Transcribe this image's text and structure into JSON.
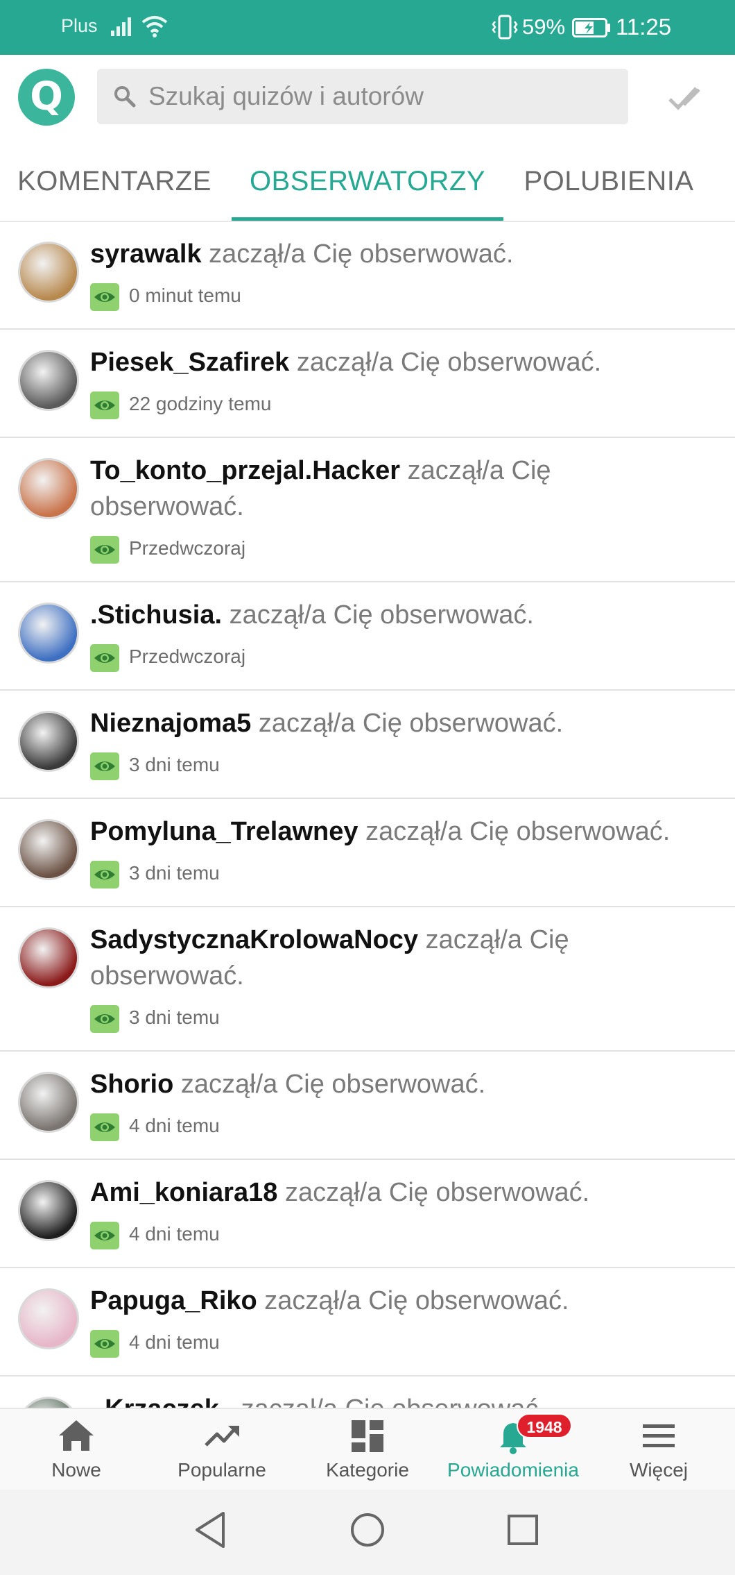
{
  "status_bar": {
    "carrier": "Plus",
    "battery_percent": "59%",
    "time": "11:25",
    "icons": [
      "signal-icon",
      "wifi-icon",
      "vibrate-icon",
      "battery-charging-icon"
    ]
  },
  "header": {
    "logo_letter": "Q",
    "search_placeholder": "Szukaj quizów i autorów",
    "search_value": "",
    "icons": [
      "search-icon",
      "mark-all-read-check-icon"
    ]
  },
  "tabs": [
    {
      "label": "KOMENTARZE",
      "active": false
    },
    {
      "label": "OBSERWATORZY",
      "active": true
    },
    {
      "label": "POLUBIENIA",
      "active": false
    }
  ],
  "notifications": [
    {
      "user": "syrawalk",
      "action": "zaczął/a Cię obserwować.",
      "time": "0 minut temu",
      "avatar_color": "#b8894e"
    },
    {
      "user": "Piesek_Szafirek",
      "action": "zaczął/a Cię obserwować.",
      "time": "22 godziny temu",
      "avatar_color": "#5a5a5a"
    },
    {
      "user": "To_konto_przejal.Hacker",
      "action": "zaczął/a Cię obserwować.",
      "time": "Przedwczoraj",
      "avatar_color": "#c9734a"
    },
    {
      "user": ".Stichusia.",
      "action": "zaczął/a Cię obserwować.",
      "time": "Przedwczoraj",
      "avatar_color": "#3d6fc2"
    },
    {
      "user": "Nieznajoma5",
      "action": "zaczął/a Cię obserwować.",
      "time": "3 dni temu",
      "avatar_color": "#3a3a3a"
    },
    {
      "user": "Pomyluna_Trelawney",
      "action": "zaczął/a Cię obserwować.",
      "time": "3 dni temu",
      "avatar_color": "#6b5244"
    },
    {
      "user": "SadystycznaKrolowaNocy",
      "action": "zaczął/a Cię obserwować.",
      "time": "3 dni temu",
      "avatar_color": "#8b1a1a"
    },
    {
      "user": "Shorio",
      "action": "zaczął/a Cię obserwować.",
      "time": "4 dni temu",
      "avatar_color": "#7a7570"
    },
    {
      "user": "Ami_koniara18",
      "action": "zaczął/a Cię obserwować.",
      "time": "4 dni temu",
      "avatar_color": "#1f1f1f"
    },
    {
      "user": "Papuga_Riko",
      "action": "zaczął/a Cię obserwować.",
      "time": "4 dni temu",
      "avatar_color": "#e7b6c8"
    },
    {
      "user": "_Krzaczek_",
      "action": "zaczął/a Cię obserwować.",
      "time": "",
      "avatar_color": "#556b5a"
    }
  ],
  "bottom_nav": [
    {
      "label": "Nowe",
      "icon": "home-icon",
      "active": false
    },
    {
      "label": "Popularne",
      "icon": "trending-icon",
      "active": false
    },
    {
      "label": "Kategorie",
      "icon": "dashboard-icon",
      "active": false
    },
    {
      "label": "Powiadomienia",
      "icon": "bell-icon",
      "active": true,
      "badge": "1948"
    },
    {
      "label": "Więcej",
      "icon": "menu-icon",
      "active": false
    }
  ],
  "colors": {
    "accent": "#26a892",
    "badge_red": "#e01f2d",
    "eye_badge_green": "#8ed16e"
  }
}
